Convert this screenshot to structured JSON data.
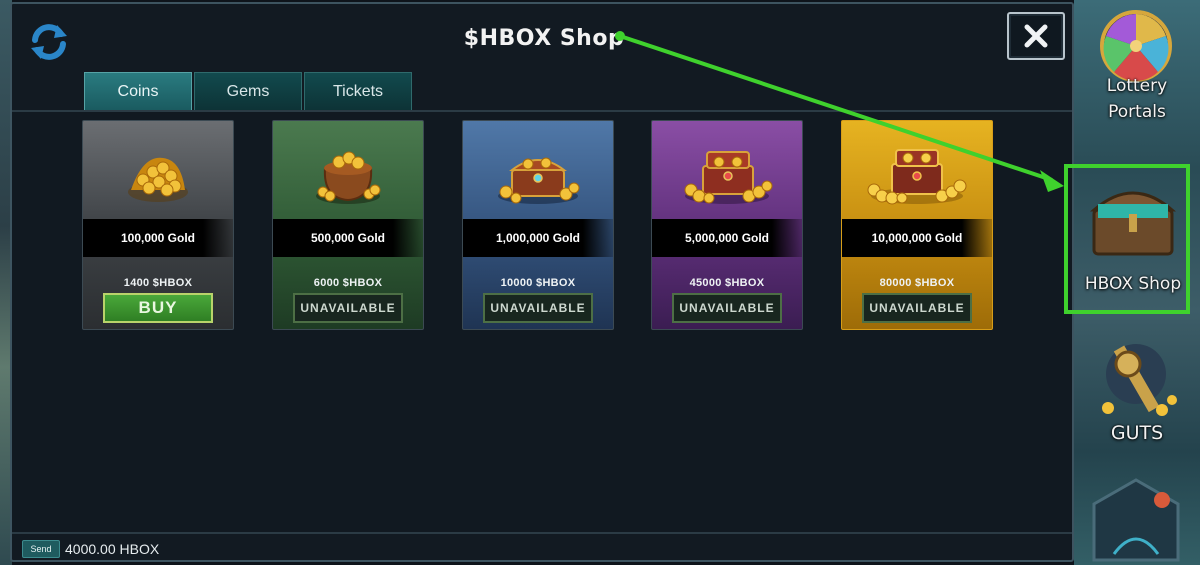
{
  "dialog": {
    "title": "$HBOX Shop",
    "refresh_icon": "refresh-icon",
    "close_icon": "close-icon"
  },
  "tabs": [
    {
      "label": "Coins",
      "active": true
    },
    {
      "label": "Gems",
      "active": false
    },
    {
      "label": "Tickets",
      "active": false
    }
  ],
  "cards": [
    {
      "name": "100,000 Gold",
      "price": "1400 $HBOX",
      "action": "BUY",
      "available": true,
      "icon": "gold-pile-icon"
    },
    {
      "name": "500,000 Gold",
      "price": "6000 $HBOX",
      "action": "UNAVAILABLE",
      "available": false,
      "icon": "gold-pot-icon"
    },
    {
      "name": "1,000,000 Gold",
      "price": "10000 $HBOX",
      "action": "UNAVAILABLE",
      "available": false,
      "icon": "treasure-chest-icon"
    },
    {
      "name": "5,000,000 Gold",
      "price": "45000 $HBOX",
      "action": "UNAVAILABLE",
      "available": false,
      "icon": "treasure-chest-icon"
    },
    {
      "name": "10,000,000 Gold",
      "price": "80000 $HBOX",
      "action": "UNAVAILABLE",
      "available": false,
      "icon": "treasure-chest-icon"
    }
  ],
  "footer": {
    "send_label": "Send",
    "amount": "4000.00 HBOX"
  },
  "side_menu": [
    {
      "label": "Lottery Portals",
      "line1": "Lottery",
      "line2": "Portals",
      "icon": "lottery-wheel-icon"
    },
    {
      "label": "HBOX Shop",
      "icon": "treasure-chest-icon",
      "highlighted": true
    },
    {
      "label": "GUTS",
      "icon": "guts-icon"
    }
  ],
  "colors": {
    "highlight": "#3fd12d",
    "arrow": "#3fd12d",
    "buy_green": "#4aa83a",
    "tab_active": "#2a7b80"
  }
}
